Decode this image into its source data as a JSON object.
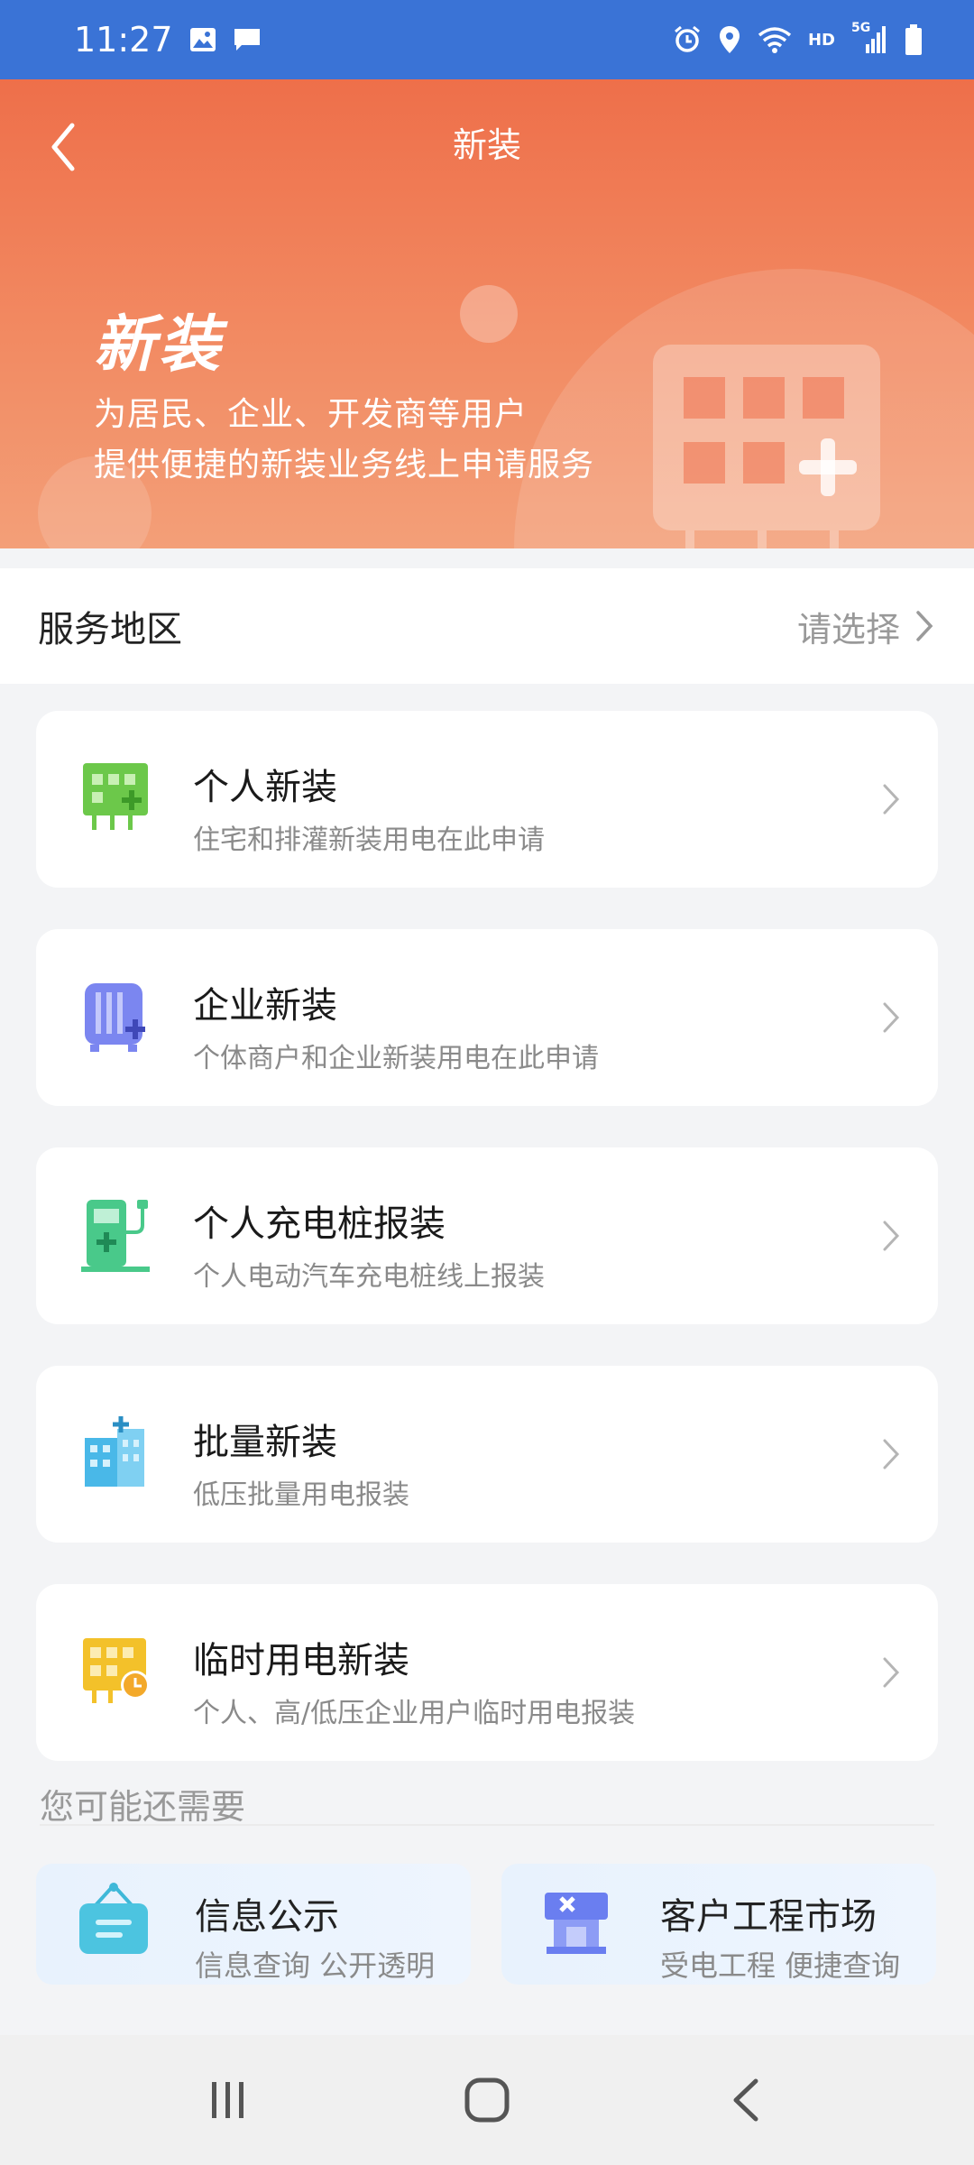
{
  "status_bar": {
    "time": "11:27",
    "left_icons": [
      "image-icon",
      "message-icon"
    ],
    "right_icons": [
      "alarm-icon",
      "location-icon",
      "wifi-icon",
      "hd-icon",
      "signal-5g-icon",
      "battery-icon"
    ],
    "hd_label": "HD",
    "net_label": "5G"
  },
  "header": {
    "title": "新装",
    "hero_title": "新装",
    "hero_line1": "为居民、企业、开发商等用户",
    "hero_line2": "提供便捷的新装业务线上申请服务"
  },
  "region": {
    "label": "服务地区",
    "value": "请选择"
  },
  "services": [
    {
      "title": "个人新装",
      "desc": "住宅和排灌新装用电在此申请",
      "icon": "meter-plus-icon",
      "color": "#6cc84a"
    },
    {
      "title": "企业新装",
      "desc": "个体商户和企业新装用电在此申请",
      "icon": "transformer-plus-icon",
      "color": "#7b86f0"
    },
    {
      "title": "个人充电桩报装",
      "desc": "个人电动汽车充电桩线上报装",
      "icon": "charger-icon",
      "color": "#49c98a"
    },
    {
      "title": "批量新装",
      "desc": "低压批量用电报装",
      "icon": "building-icon",
      "color": "#49b8e8"
    },
    {
      "title": "临时用电新装",
      "desc": "个人、高/低压企业用户临时用电报装",
      "icon": "meter-clock-icon",
      "color": "#f3c12a"
    }
  ],
  "more": {
    "section_title": "您可能还需要",
    "items": [
      {
        "title": "信息公示",
        "desc": "信息查询 公开透明",
        "icon": "notice-board-icon"
      },
      {
        "title": "客户工程市场",
        "desc": "受电工程 便捷查询",
        "icon": "tools-icon"
      }
    ]
  },
  "nav": {
    "buttons": [
      "recents-icon",
      "home-icon",
      "back-icon"
    ]
  }
}
